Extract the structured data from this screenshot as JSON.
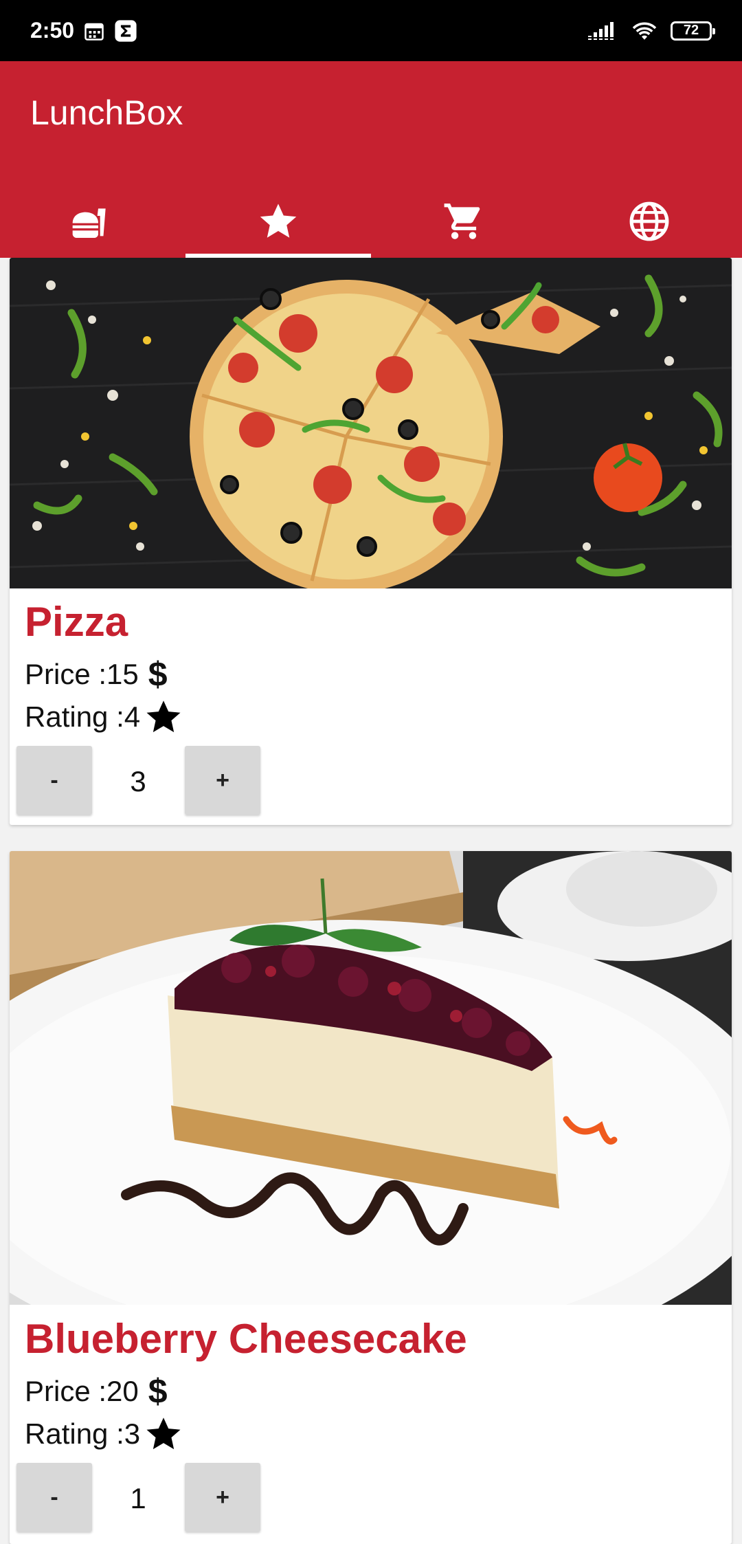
{
  "status_bar": {
    "time": "2:50",
    "battery": "72"
  },
  "app": {
    "title": "LunchBox"
  },
  "tabs": [
    {
      "icon": "fastfood-icon",
      "active": false
    },
    {
      "icon": "star-icon",
      "active": true
    },
    {
      "icon": "cart-icon",
      "active": false
    },
    {
      "icon": "globe-icon",
      "active": false
    }
  ],
  "colors": {
    "primary": "#c62130",
    "background": "#f2f2f2",
    "button": "#d8d8d8"
  },
  "items": [
    {
      "name": "Pizza",
      "price_label": "Price :",
      "price": "15",
      "currency": "$",
      "rating_label": "Rating :",
      "rating": "4",
      "decrement_label": "-",
      "quantity": "3",
      "increment_label": "+"
    },
    {
      "name": "Blueberry Cheesecake",
      "price_label": "Price :",
      "price": "20",
      "currency": "$",
      "rating_label": "Rating :",
      "rating": "3",
      "decrement_label": "-",
      "quantity": "1",
      "increment_label": "+"
    }
  ]
}
